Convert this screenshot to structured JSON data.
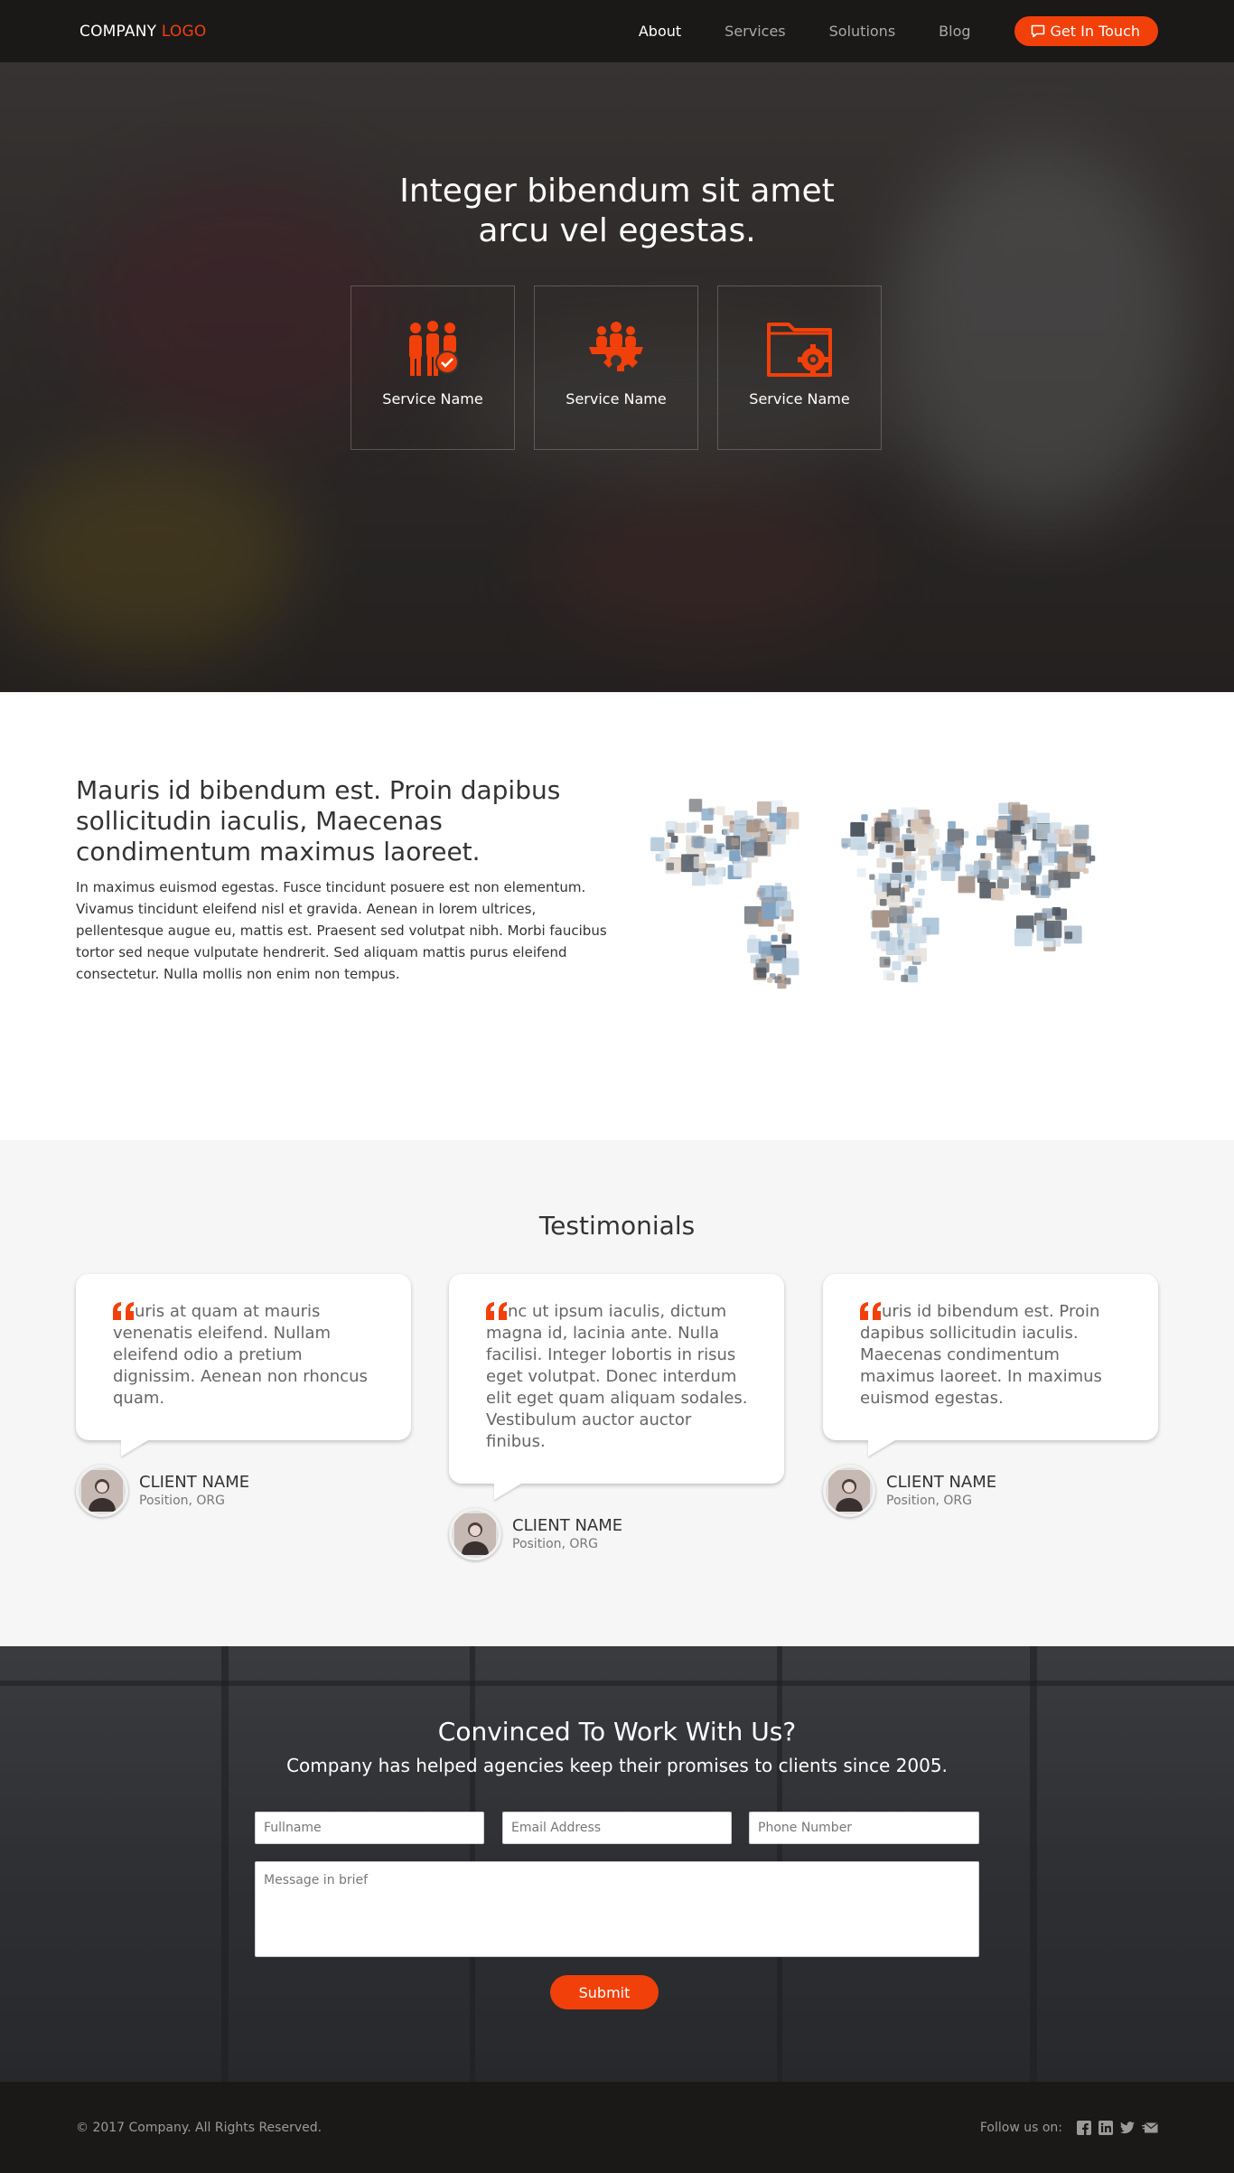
{
  "nav": {
    "logo_main": "COMPANY",
    "logo_accent": "LOGO",
    "links": [
      {
        "label": "About"
      },
      {
        "label": "Services"
      },
      {
        "label": "Solutions"
      },
      {
        "label": "Blog"
      }
    ],
    "active_link": "About",
    "cta_label": "Get In Touch",
    "cta_icon": "chat-bubble-icon"
  },
  "hero": {
    "title_line1": "Integer bibendum sit amet",
    "title_line2": "arcu vel egestas.",
    "services": [
      {
        "label": "Service Name",
        "icon": "team-check-icon"
      },
      {
        "label": "Service Name",
        "icon": "team-gear-icon"
      },
      {
        "label": "Service Name",
        "icon": "folder-gear-icon"
      }
    ]
  },
  "about": {
    "heading": "Mauris id bibendum est. Proin dapibus sollicitudin iaculis, Maecenas condimentum maximus laoreet.",
    "body": "In maximus euismod egestas. Fusce tincidunt posuere est non elementum. Vivamus tincidunt eleifend nisl et gravida. Aenean in lorem ultrices, pellentesque augue eu, mattis est. Praesent sed volutpat nibh. Morbi faucibus tortor sed neque vulputate hendrerit. Sed aliquam mattis purus eleifend consectetur. Nulla mollis non enim non tempus.",
    "image": "world-map-of-people-photos"
  },
  "testimonials": {
    "title": "Testimonials",
    "items": [
      {
        "quote": "uris at quam at mauris venenatis eleifend. Nullam eleifend odio a pretium dignissim. Aenean non rhoncus quam.",
        "name": "CLIENT NAME",
        "position": "Position, ORG"
      },
      {
        "quote": "nc ut ipsum iaculis, dictum magna id, lacinia ante. Nulla facilisi. Integer lobortis in risus eget volutpat. Donec interdum elit eget quam aliquam sodales. Vestibulum auctor auctor finibus.",
        "name": "CLIENT NAME",
        "position": "Position, ORG"
      },
      {
        "quote": "uris id bibendum est. Proin dapibus sollicitudin iaculis. Maecenas condimentum maximus laoreet. In maximus euismod egestas.",
        "name": "CLIENT NAME",
        "position": "Position, ORG"
      }
    ]
  },
  "contact": {
    "title": "Convinced To Work With Us?",
    "subtitle": "Company has helped agencies keep their promises to clients since 2005.",
    "fullname_placeholder": "Fullname",
    "email_placeholder": "Email Address",
    "phone_placeholder": "Phone Number",
    "message_placeholder": "Message in brief",
    "submit_label": "Submit"
  },
  "footer": {
    "copyright": "© 2017 Company. All Rights Reserved.",
    "follow_label": "Follow us on:",
    "social_icons": [
      "facebook-icon",
      "linkedin-icon",
      "twitter-icon",
      "email-icon"
    ]
  },
  "colors": {
    "accent": "#f2400a",
    "dark_bar": "#1a1918",
    "section_gray": "#f6f6f6"
  }
}
